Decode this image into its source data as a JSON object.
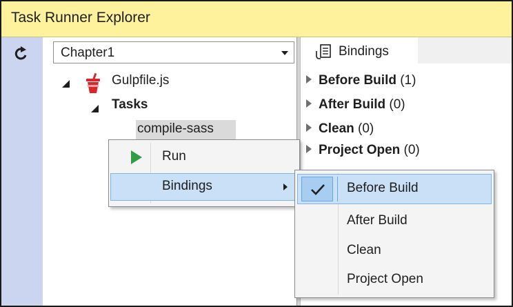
{
  "window": {
    "title": "Task Runner Explorer"
  },
  "toolbar": {
    "refresh_icon": "refresh-icon"
  },
  "project_select": {
    "value": "Chapter1"
  },
  "tree": {
    "file": {
      "label": "Gulpfile.js",
      "icon": "gulp-icon"
    },
    "tasks_label": "Tasks",
    "task": {
      "label": "compile-sass"
    }
  },
  "context_menu": {
    "run_label": "Run",
    "bindings_label": "Bindings"
  },
  "bindings_submenu": {
    "items": [
      {
        "label": "Before Build",
        "checked": true
      },
      {
        "label": "After Build",
        "checked": false
      },
      {
        "label": "Clean",
        "checked": false
      },
      {
        "label": "Project Open",
        "checked": false
      }
    ]
  },
  "right_panel": {
    "tab_label": "Bindings",
    "tab_icon": "bindings-icon",
    "items": [
      {
        "name": "Before Build",
        "count": "(1)"
      },
      {
        "name": "After Build",
        "count": "(0)"
      },
      {
        "name": "Clean",
        "count": "(0)"
      },
      {
        "name": "Project Open",
        "count": "(0)"
      }
    ]
  },
  "colors": {
    "title_bar": "#fff29d",
    "toolbar_strip": "#ccd5f0",
    "menu_highlight": "#c9e0f7",
    "run_play": "#2f9e44",
    "gulp_red": "#d8272c"
  }
}
